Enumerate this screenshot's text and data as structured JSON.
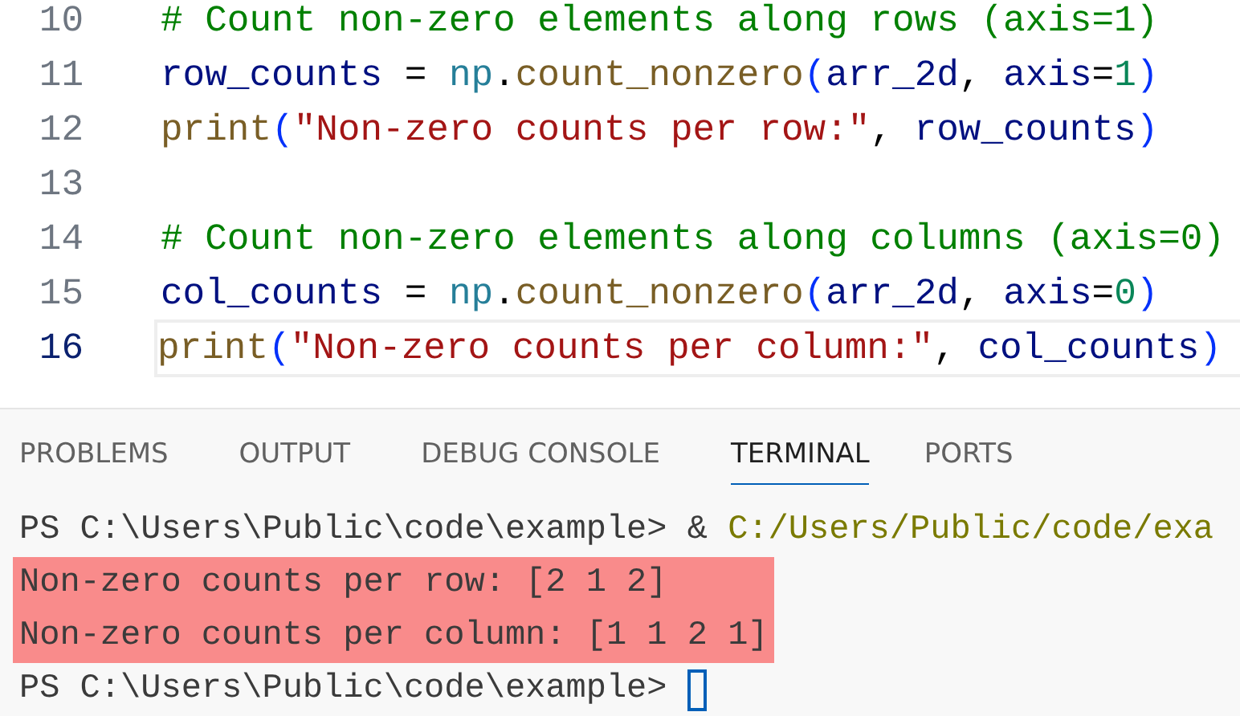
{
  "editor": {
    "lines": [
      {
        "number": "10",
        "current": false,
        "tokens": [
          {
            "kind": "comment",
            "text": "# Count non-zero elements along rows (axis=1)"
          }
        ]
      },
      {
        "number": "11",
        "current": false,
        "tokens": [
          {
            "kind": "variable",
            "text": "row_counts"
          },
          {
            "kind": "plain",
            "text": " = "
          },
          {
            "kind": "module",
            "text": "np"
          },
          {
            "kind": "plain",
            "text": "."
          },
          {
            "kind": "function",
            "text": "count_nonzero"
          },
          {
            "kind": "paren",
            "text": "("
          },
          {
            "kind": "variable",
            "text": "arr_2d"
          },
          {
            "kind": "plain",
            "text": ", "
          },
          {
            "kind": "variable",
            "text": "axis"
          },
          {
            "kind": "plain",
            "text": "="
          },
          {
            "kind": "number",
            "text": "1"
          },
          {
            "kind": "paren",
            "text": ")"
          }
        ]
      },
      {
        "number": "12",
        "current": false,
        "tokens": [
          {
            "kind": "function",
            "text": "print"
          },
          {
            "kind": "paren",
            "text": "("
          },
          {
            "kind": "string",
            "text": "\"Non-zero counts per row:\""
          },
          {
            "kind": "plain",
            "text": ", "
          },
          {
            "kind": "variable",
            "text": "row_counts"
          },
          {
            "kind": "paren",
            "text": ")"
          }
        ]
      },
      {
        "number": "13",
        "current": false
      },
      {
        "number": "14",
        "current": false,
        "tokens": [
          {
            "kind": "comment",
            "text": "# Count non-zero elements along columns (axis=0)"
          }
        ]
      },
      {
        "number": "15",
        "current": false,
        "tokens": [
          {
            "kind": "variable",
            "text": "col_counts"
          },
          {
            "kind": "plain",
            "text": " = "
          },
          {
            "kind": "module",
            "text": "np"
          },
          {
            "kind": "plain",
            "text": "."
          },
          {
            "kind": "function",
            "text": "count_nonzero"
          },
          {
            "kind": "paren",
            "text": "("
          },
          {
            "kind": "variable",
            "text": "arr_2d"
          },
          {
            "kind": "plain",
            "text": ", "
          },
          {
            "kind": "variable",
            "text": "axis"
          },
          {
            "kind": "plain",
            "text": "="
          },
          {
            "kind": "number",
            "text": "0"
          },
          {
            "kind": "paren",
            "text": ")"
          }
        ]
      },
      {
        "number": "16",
        "current": true,
        "tokens": [
          {
            "kind": "function",
            "text": "print"
          },
          {
            "kind": "paren",
            "text": "("
          },
          {
            "kind": "string",
            "text": "\"Non-zero counts per column:\""
          },
          {
            "kind": "plain",
            "text": ", "
          },
          {
            "kind": "variable",
            "text": "col_counts"
          },
          {
            "kind": "paren",
            "text": ")"
          }
        ]
      }
    ]
  },
  "panel": {
    "tabs": [
      {
        "label": "PROBLEMS",
        "selected": false
      },
      {
        "label": "OUTPUT",
        "selected": false
      },
      {
        "label": "DEBUG CONSOLE",
        "selected": false
      },
      {
        "label": "TERMINAL",
        "selected": true
      },
      {
        "label": "PORTS",
        "selected": false
      }
    ],
    "terminal": {
      "lines": [
        {
          "highlighted": false,
          "cursor": false,
          "segments": [
            {
              "kind": "plain",
              "text": "PS C:\\Users\\Public\\code\\example> & "
            },
            {
              "kind": "path",
              "text": "C:/Users/Public/code/exa"
            }
          ]
        },
        {
          "highlighted": true,
          "cursor": false,
          "segments": [
            {
              "kind": "plain",
              "text": "Non-zero counts per row: [2 1 2]"
            }
          ]
        },
        {
          "highlighted": true,
          "cursor": false,
          "segments": [
            {
              "kind": "plain",
              "text": "Non-zero counts per column: [1 1 2 1]"
            }
          ]
        },
        {
          "highlighted": false,
          "cursor": true,
          "segments": [
            {
              "kind": "plain",
              "text": "PS C:\\Users\\Public\\code\\example> "
            }
          ]
        }
      ]
    }
  }
}
